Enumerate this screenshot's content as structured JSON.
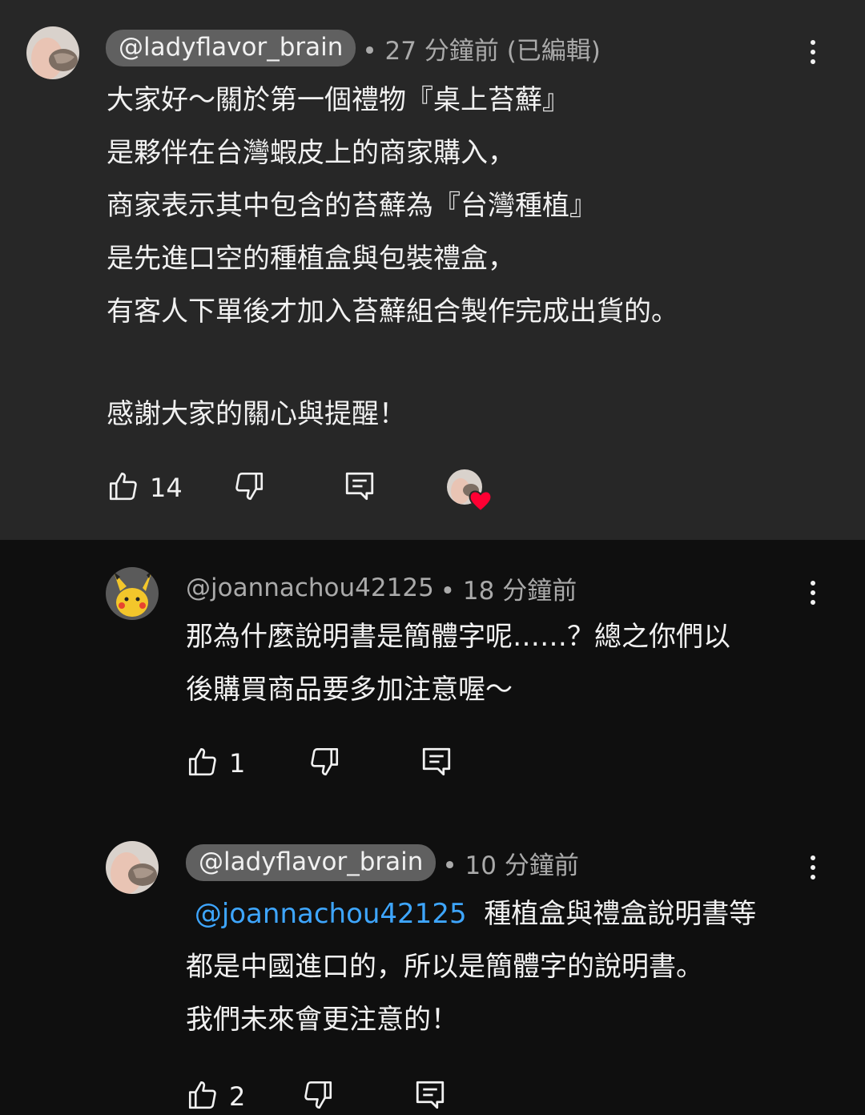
{
  "comments": [
    {
      "handle": "@ladyflavor_brain",
      "time": "• 27 分鐘前 (已編輯)",
      "lines": [
        "大家好～關於第一個禮物『桌上苔蘚』",
        "是夥伴在台灣蝦皮上的商家購入，",
        "商家表示其中包含的苔蘚為『台灣種植』",
        "是先進口空的種植盒與包裝禮盒，",
        "有客人下單後才加入苔蘚組合製作完成出貨的。",
        "",
        "感謝大家的關心與提醒！"
      ],
      "likes": "14",
      "hearted": true
    },
    {
      "handle": "@joannachou42125",
      "time": "• 18 分鐘前",
      "lines": [
        "那為什麼說明書是簡體字呢……？總之你們以",
        "後購買商品要多加注意喔～"
      ],
      "likes": "1"
    },
    {
      "handle": "@ladyflavor_brain",
      "time": "• 10 分鐘前",
      "mention": "@joannachou42125",
      "lines": [
        "種植盒與禮盒說明書等",
        "都是中國進口的，所以是簡體字的說明書。",
        "我們未來會更注意的！"
      ],
      "likes": "2"
    }
  ],
  "icons": {
    "like": "thumb-up-icon",
    "dislike": "thumb-down-icon",
    "reply": "reply-icon",
    "more": "more-vert-icon",
    "heart": "heart-icon"
  },
  "colors": {
    "pinned_bg": "#272727",
    "page_bg": "#0f0f0f",
    "mention": "#3ea6ff",
    "heart": "#ff0033"
  }
}
